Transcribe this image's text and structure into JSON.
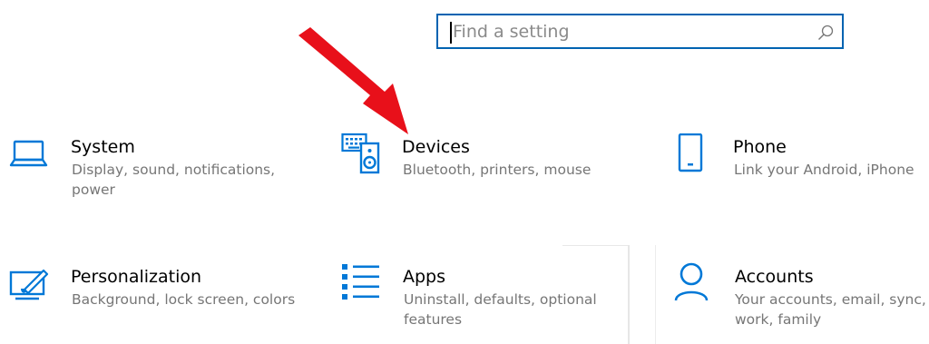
{
  "search": {
    "placeholder": "Find a setting",
    "icon": "search-icon"
  },
  "tiles": [
    {
      "id": "system",
      "icon": "laptop-icon",
      "title": "System",
      "description": "Display, sound, notifications, power"
    },
    {
      "id": "devices",
      "icon": "devices-icon",
      "title": "Devices",
      "description": "Bluetooth, printers, mouse"
    },
    {
      "id": "phone",
      "icon": "phone-icon",
      "title": "Phone",
      "description": "Link your Android, iPhone"
    },
    {
      "id": "personalization",
      "icon": "personalization-icon",
      "title": "Personalization",
      "description": "Background, lock screen, colors"
    },
    {
      "id": "apps",
      "icon": "apps-list-icon",
      "title": "Apps",
      "description": "Uninstall, defaults, optional features"
    },
    {
      "id": "accounts",
      "icon": "person-icon",
      "title": "Accounts",
      "description": "Your accounts, email, sync, work, family"
    }
  ],
  "annotation": {
    "icon": "red-arrow-icon",
    "color": "#e8101a"
  },
  "colors": {
    "accent": "#0063b1",
    "icon": "#0078d7",
    "description": "#767676"
  }
}
